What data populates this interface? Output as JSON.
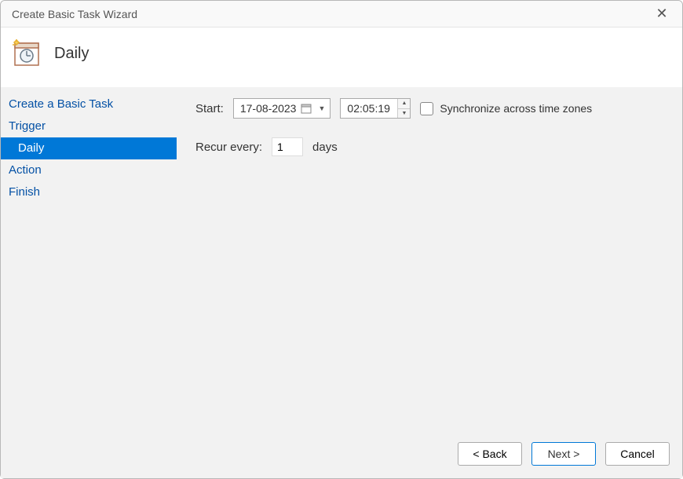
{
  "window": {
    "title": "Create Basic Task Wizard"
  },
  "header": {
    "page_title": "Daily"
  },
  "sidebar": {
    "items": [
      {
        "label": "Create a Basic Task",
        "sub": false,
        "active": false
      },
      {
        "label": "Trigger",
        "sub": false,
        "active": false
      },
      {
        "label": "Daily",
        "sub": true,
        "active": true
      },
      {
        "label": "Action",
        "sub": false,
        "active": false
      },
      {
        "label": "Finish",
        "sub": false,
        "active": false
      }
    ]
  },
  "content": {
    "start_label": "Start:",
    "date_value": "17-08-2023",
    "time_value": "02:05:19",
    "sync_label": "Synchronize across time zones",
    "sync_checked": false,
    "recur_label": "Recur every:",
    "recur_value": "1",
    "recur_unit": "days"
  },
  "footer": {
    "back": "< Back",
    "next": "Next >",
    "cancel": "Cancel"
  }
}
